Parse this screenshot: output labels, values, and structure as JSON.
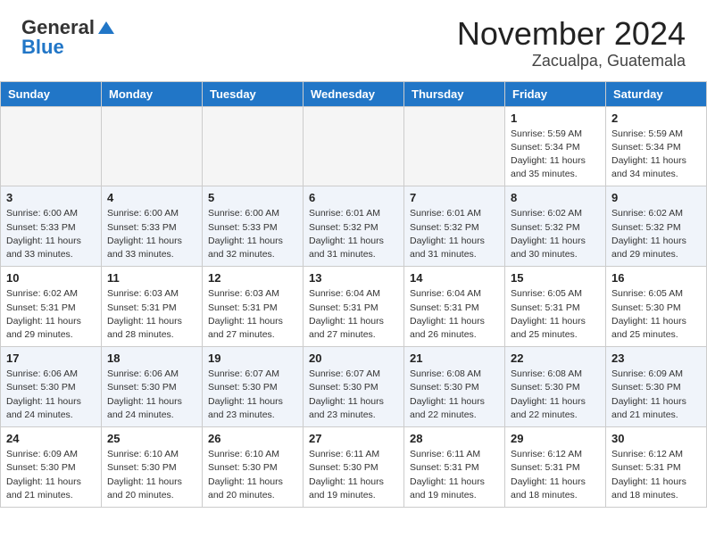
{
  "header": {
    "logo_general": "General",
    "logo_blue": "Blue",
    "title": "November 2024",
    "subtitle": "Zacualpa, Guatemala"
  },
  "days_of_week": [
    "Sunday",
    "Monday",
    "Tuesday",
    "Wednesday",
    "Thursday",
    "Friday",
    "Saturday"
  ],
  "weeks": [
    [
      {
        "day": "",
        "sunrise": "",
        "sunset": "",
        "daylight": "",
        "empty": true
      },
      {
        "day": "",
        "sunrise": "",
        "sunset": "",
        "daylight": "",
        "empty": true
      },
      {
        "day": "",
        "sunrise": "",
        "sunset": "",
        "daylight": "",
        "empty": true
      },
      {
        "day": "",
        "sunrise": "",
        "sunset": "",
        "daylight": "",
        "empty": true
      },
      {
        "day": "",
        "sunrise": "",
        "sunset": "",
        "daylight": "",
        "empty": true
      },
      {
        "day": "1",
        "sunrise": "Sunrise: 5:59 AM",
        "sunset": "Sunset: 5:34 PM",
        "daylight": "Daylight: 11 hours and 35 minutes.",
        "empty": false
      },
      {
        "day": "2",
        "sunrise": "Sunrise: 5:59 AM",
        "sunset": "Sunset: 5:34 PM",
        "daylight": "Daylight: 11 hours and 34 minutes.",
        "empty": false
      }
    ],
    [
      {
        "day": "3",
        "sunrise": "Sunrise: 6:00 AM",
        "sunset": "Sunset: 5:33 PM",
        "daylight": "Daylight: 11 hours and 33 minutes.",
        "empty": false
      },
      {
        "day": "4",
        "sunrise": "Sunrise: 6:00 AM",
        "sunset": "Sunset: 5:33 PM",
        "daylight": "Daylight: 11 hours and 33 minutes.",
        "empty": false
      },
      {
        "day": "5",
        "sunrise": "Sunrise: 6:00 AM",
        "sunset": "Sunset: 5:33 PM",
        "daylight": "Daylight: 11 hours and 32 minutes.",
        "empty": false
      },
      {
        "day": "6",
        "sunrise": "Sunrise: 6:01 AM",
        "sunset": "Sunset: 5:32 PM",
        "daylight": "Daylight: 11 hours and 31 minutes.",
        "empty": false
      },
      {
        "day": "7",
        "sunrise": "Sunrise: 6:01 AM",
        "sunset": "Sunset: 5:32 PM",
        "daylight": "Daylight: 11 hours and 31 minutes.",
        "empty": false
      },
      {
        "day": "8",
        "sunrise": "Sunrise: 6:02 AM",
        "sunset": "Sunset: 5:32 PM",
        "daylight": "Daylight: 11 hours and 30 minutes.",
        "empty": false
      },
      {
        "day": "9",
        "sunrise": "Sunrise: 6:02 AM",
        "sunset": "Sunset: 5:32 PM",
        "daylight": "Daylight: 11 hours and 29 minutes.",
        "empty": false
      }
    ],
    [
      {
        "day": "10",
        "sunrise": "Sunrise: 6:02 AM",
        "sunset": "Sunset: 5:31 PM",
        "daylight": "Daylight: 11 hours and 29 minutes.",
        "empty": false
      },
      {
        "day": "11",
        "sunrise": "Sunrise: 6:03 AM",
        "sunset": "Sunset: 5:31 PM",
        "daylight": "Daylight: 11 hours and 28 minutes.",
        "empty": false
      },
      {
        "day": "12",
        "sunrise": "Sunrise: 6:03 AM",
        "sunset": "Sunset: 5:31 PM",
        "daylight": "Daylight: 11 hours and 27 minutes.",
        "empty": false
      },
      {
        "day": "13",
        "sunrise": "Sunrise: 6:04 AM",
        "sunset": "Sunset: 5:31 PM",
        "daylight": "Daylight: 11 hours and 27 minutes.",
        "empty": false
      },
      {
        "day": "14",
        "sunrise": "Sunrise: 6:04 AM",
        "sunset": "Sunset: 5:31 PM",
        "daylight": "Daylight: 11 hours and 26 minutes.",
        "empty": false
      },
      {
        "day": "15",
        "sunrise": "Sunrise: 6:05 AM",
        "sunset": "Sunset: 5:31 PM",
        "daylight": "Daylight: 11 hours and 25 minutes.",
        "empty": false
      },
      {
        "day": "16",
        "sunrise": "Sunrise: 6:05 AM",
        "sunset": "Sunset: 5:30 PM",
        "daylight": "Daylight: 11 hours and 25 minutes.",
        "empty": false
      }
    ],
    [
      {
        "day": "17",
        "sunrise": "Sunrise: 6:06 AM",
        "sunset": "Sunset: 5:30 PM",
        "daylight": "Daylight: 11 hours and 24 minutes.",
        "empty": false
      },
      {
        "day": "18",
        "sunrise": "Sunrise: 6:06 AM",
        "sunset": "Sunset: 5:30 PM",
        "daylight": "Daylight: 11 hours and 24 minutes.",
        "empty": false
      },
      {
        "day": "19",
        "sunrise": "Sunrise: 6:07 AM",
        "sunset": "Sunset: 5:30 PM",
        "daylight": "Daylight: 11 hours and 23 minutes.",
        "empty": false
      },
      {
        "day": "20",
        "sunrise": "Sunrise: 6:07 AM",
        "sunset": "Sunset: 5:30 PM",
        "daylight": "Daylight: 11 hours and 23 minutes.",
        "empty": false
      },
      {
        "day": "21",
        "sunrise": "Sunrise: 6:08 AM",
        "sunset": "Sunset: 5:30 PM",
        "daylight": "Daylight: 11 hours and 22 minutes.",
        "empty": false
      },
      {
        "day": "22",
        "sunrise": "Sunrise: 6:08 AM",
        "sunset": "Sunset: 5:30 PM",
        "daylight": "Daylight: 11 hours and 22 minutes.",
        "empty": false
      },
      {
        "day": "23",
        "sunrise": "Sunrise: 6:09 AM",
        "sunset": "Sunset: 5:30 PM",
        "daylight": "Daylight: 11 hours and 21 minutes.",
        "empty": false
      }
    ],
    [
      {
        "day": "24",
        "sunrise": "Sunrise: 6:09 AM",
        "sunset": "Sunset: 5:30 PM",
        "daylight": "Daylight: 11 hours and 21 minutes.",
        "empty": false
      },
      {
        "day": "25",
        "sunrise": "Sunrise: 6:10 AM",
        "sunset": "Sunset: 5:30 PM",
        "daylight": "Daylight: 11 hours and 20 minutes.",
        "empty": false
      },
      {
        "day": "26",
        "sunrise": "Sunrise: 6:10 AM",
        "sunset": "Sunset: 5:30 PM",
        "daylight": "Daylight: 11 hours and 20 minutes.",
        "empty": false
      },
      {
        "day": "27",
        "sunrise": "Sunrise: 6:11 AM",
        "sunset": "Sunset: 5:30 PM",
        "daylight": "Daylight: 11 hours and 19 minutes.",
        "empty": false
      },
      {
        "day": "28",
        "sunrise": "Sunrise: 6:11 AM",
        "sunset": "Sunset: 5:31 PM",
        "daylight": "Daylight: 11 hours and 19 minutes.",
        "empty": false
      },
      {
        "day": "29",
        "sunrise": "Sunrise: 6:12 AM",
        "sunset": "Sunset: 5:31 PM",
        "daylight": "Daylight: 11 hours and 18 minutes.",
        "empty": false
      },
      {
        "day": "30",
        "sunrise": "Sunrise: 6:12 AM",
        "sunset": "Sunset: 5:31 PM",
        "daylight": "Daylight: 11 hours and 18 minutes.",
        "empty": false
      }
    ]
  ]
}
